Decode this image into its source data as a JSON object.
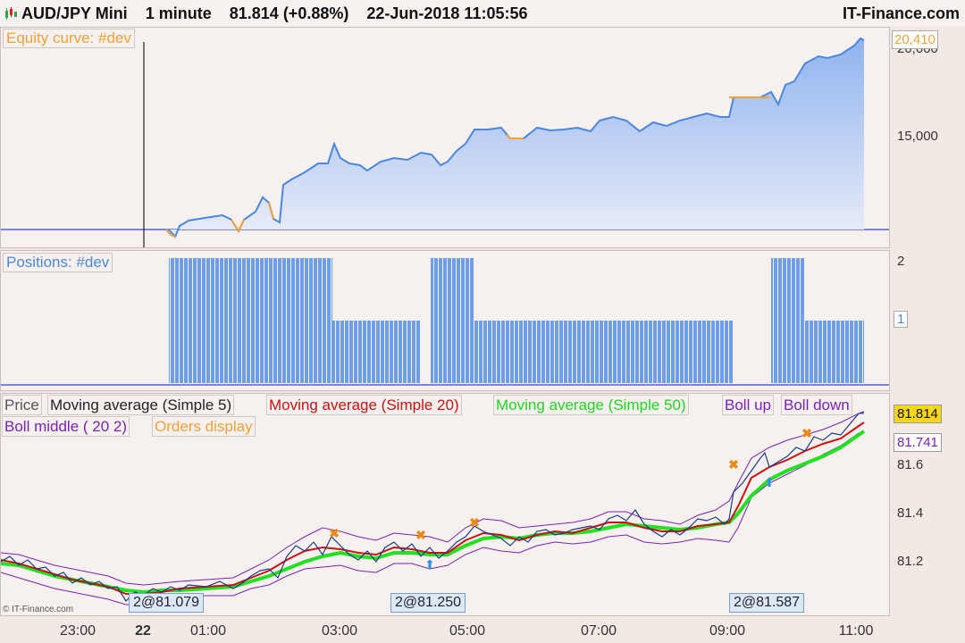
{
  "header": {
    "instrument": "AUD/JPY Mini",
    "timeframe": "1 minute",
    "last_price": "81.814",
    "change": "(+0.88%)",
    "datetime": "22-Jun-2018 11:05:56",
    "brand": "IT-Finance.com"
  },
  "equity_panel": {
    "title": "Equity curve: #dev",
    "current_value_label": "20,410",
    "axis_labels": [
      "20,000",
      "15,000"
    ]
  },
  "positions_panel": {
    "title": "Positions: #dev",
    "axis_labels": [
      "2",
      "1"
    ]
  },
  "price_panel": {
    "legend": {
      "price": "Price",
      "ma5": "Moving average (Simple 5)",
      "ma20": "Moving average (Simple 20)",
      "ma50": "Moving average (Simple 50)",
      "boll_up": "Boll up",
      "boll_down": "Boll down",
      "boll_middle": "Boll middle ( 20 2)",
      "orders": "Orders display"
    },
    "axis_labels": [
      "81.6",
      "81.4",
      "81.2"
    ],
    "price_tag": "81.814",
    "boll_tag": "81.741",
    "orders": [
      "2@81.079",
      "2@81.250",
      "2@81.587"
    ]
  },
  "x_axis": [
    "23:00",
    "22",
    "01:00",
    "03:00",
    "05:00",
    "07:00",
    "09:00",
    "11:00"
  ],
  "copyright": "© IT-Finance.com",
  "colors": {
    "equity_fill": "#a9c4f1",
    "equity_line": "#4c86df",
    "equity_highlight": "#f0a23a",
    "positions_bar": "#6f9ee8",
    "ma5": "#1b3a8c",
    "ma20": "#cc1111",
    "ma50": "#22e022",
    "boll": "#7a22b8"
  }
}
